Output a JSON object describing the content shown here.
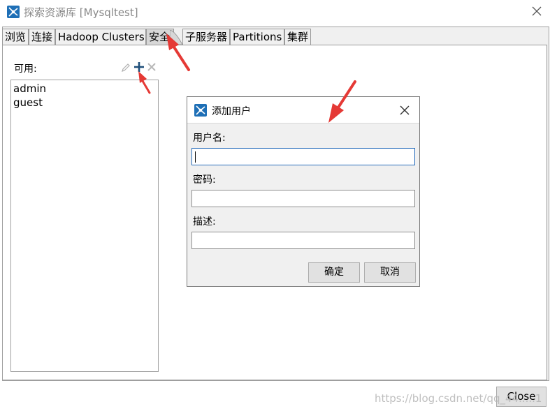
{
  "window": {
    "title": "探索资源库 [Mysqltest]",
    "close_icon": "close-icon"
  },
  "tabs": [
    {
      "label": "浏览",
      "active": false
    },
    {
      "label": "连接",
      "active": false
    },
    {
      "label": "Hadoop Clusters",
      "active": false
    },
    {
      "label": "安全",
      "active": true
    },
    {
      "label": "子服务器",
      "active": false
    },
    {
      "label": "Partitions",
      "active": false
    },
    {
      "label": "集群",
      "active": false
    }
  ],
  "security": {
    "available_label": "可用:",
    "toolbar": {
      "edit_icon": "pencil-icon",
      "add_icon": "plus-icon",
      "delete_icon": "close-icon"
    },
    "users": [
      "admin",
      "guest"
    ]
  },
  "dialog": {
    "title": "添加用户",
    "username_label": "用户名:",
    "username_value": "",
    "password_label": "密码:",
    "password_value": "",
    "description_label": "描述:",
    "description_value": "",
    "ok_label": "确定",
    "cancel_label": "取消"
  },
  "footer": {
    "close_label": "Close"
  },
  "watermark": "https://blog.csdn.net/qq_44.....1",
  "colors": {
    "accent": "#1e6fb6",
    "arrow": "#e53935",
    "focus": "#2a6ebc"
  }
}
